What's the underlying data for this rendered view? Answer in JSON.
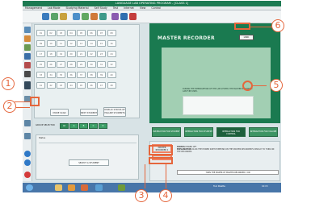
{
  "window": {
    "title": "LANGUAGE LAB OPERATING PROGRAM - [CLASS 1]"
  },
  "menu": [
    "Management",
    "Lab Mode",
    "Studying Material",
    "Self Study",
    "Test",
    "Internet",
    "View",
    "Control"
  ],
  "keypad": {
    "keys": [
      "01",
      "02",
      "03",
      "04",
      "05",
      "06",
      "07",
      "08",
      "09",
      "10",
      "11",
      "12",
      "13",
      "14",
      "15",
      "16",
      "17",
      "18",
      "19",
      "20",
      "21",
      "22",
      "23",
      "24",
      "25",
      "26",
      "27",
      "28",
      "29",
      "30",
      "31",
      "32",
      "33",
      "34",
      "35",
      "36",
      "37",
      "38",
      "39",
      "40",
      "41",
      "42",
      "43",
      "44",
      "45",
      "46",
      "47",
      "48"
    ],
    "buttons": [
      "MODE SCAN",
      "NEXT STUDENT",
      "DISPLAY STATUS OF FAILURE STUDENTS"
    ]
  },
  "group_selector": {
    "label": "GROUP SELECTOR",
    "groups": [
      "All",
      "A",
      "B",
      "C",
      "D"
    ]
  },
  "student_panel": {
    "header": "Status",
    "select_label": "SELECT A STUDENT"
  },
  "master_recorder": {
    "title": "MASTER RECORDER",
    "link_label": "LINK",
    "instruction": "DURING THE INTERRUPTION OF THE LAB SYSTEM, THE MASTER RECORDER CAN'T BE USED."
  },
  "tabs": [
    "INSTRUCTOR FOR STUDENT",
    "INTERACTION FOR STUDENT",
    "INTERACTION FOR CONTROL",
    "INTERACTION FOR VOLUME"
  ],
  "info": {
    "master_btn": "MASTER RECORDER 1",
    "status_label": "STATUS",
    "status_value": "POWER OFF",
    "explanation_label": "EXPLANATION",
    "explanation_value": "CLICK THE POWER SWITCH BEHIND ON THE MASTER RECORDER'S DISPLAY TO TURN ON THE RECORDER.",
    "action": "TURN THE POWER OF MASTER RECORDER 1 ON"
  },
  "taskbar": {
    "lang": "Tool Palette",
    "time": "10:15"
  },
  "callouts": [
    "1",
    "2",
    "3",
    "4",
    "5",
    "6"
  ],
  "colors": {
    "accent": "#e5663c",
    "panel_green": "#1a7a50",
    "taskbar": "#4876a9"
  }
}
